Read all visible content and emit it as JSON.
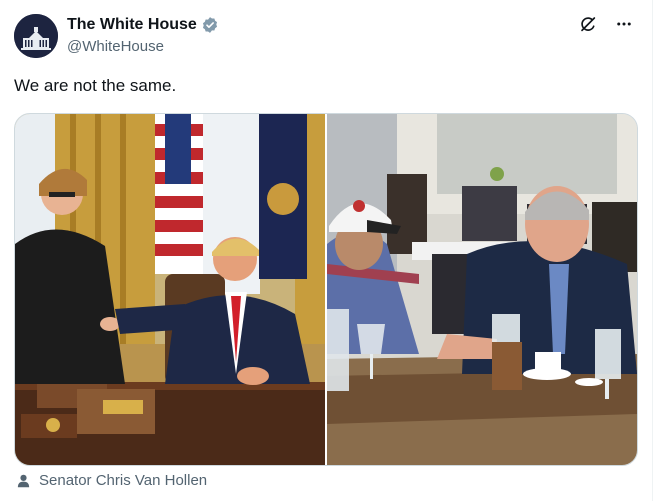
{
  "author": {
    "display_name": "The White House",
    "handle": "@WhiteHouse",
    "verified_badge": "gray-check-badge-icon",
    "avatar_icon": "white-house-avatar-icon"
  },
  "actions": {
    "grok_icon": "grok-icon",
    "more_icon": "more-horizontal-icon"
  },
  "tweet": {
    "text": "We are not the same."
  },
  "media": {
    "images": [
      {
        "description_icon": "oval-office-photo"
      },
      {
        "description_icon": "restaurant-meeting-photo"
      }
    ]
  },
  "tag": {
    "icon": "person-icon",
    "label": "Senator Chris Van Hollen"
  },
  "colors": {
    "text_primary": "#0f1419",
    "text_secondary": "#536471",
    "border": "#cfd9de",
    "badge_gray": "#829aab"
  }
}
